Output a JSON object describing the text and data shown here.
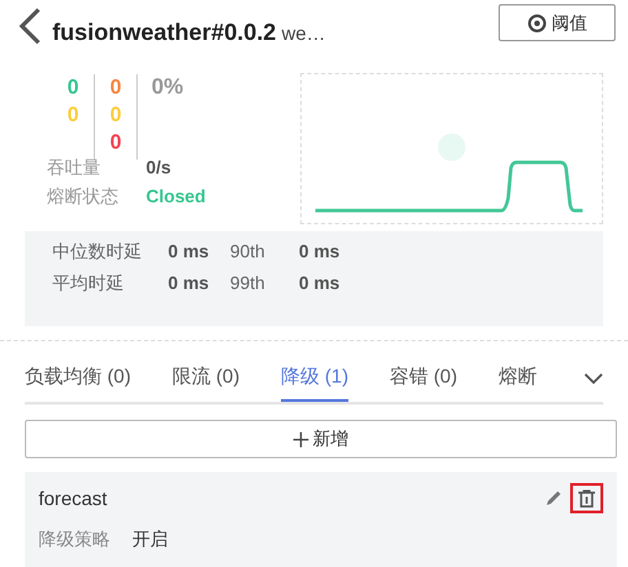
{
  "header": {
    "title": "fusionweather#0.0.2",
    "subtitle": "we…",
    "threshold_button": "阈值"
  },
  "counters": [
    {
      "values": [
        {
          "text": "0",
          "color": "#36c690"
        },
        {
          "text": "0",
          "color": "#fbcd3a"
        }
      ]
    },
    {
      "values": [
        {
          "text": "0",
          "color": "#f7863f"
        },
        {
          "text": "0",
          "color": "#fbcd3a"
        },
        {
          "text": "0",
          "color": "#f5434f"
        }
      ]
    }
  ],
  "percentage": "0%",
  "stats": [
    {
      "label": "吞吐量",
      "value": "0/s",
      "kind": "plain"
    },
    {
      "label": "熔断状态",
      "value": "Closed",
      "kind": "status"
    }
  ],
  "latency": [
    {
      "label": "中位数时延",
      "value": "0 ms",
      "percentile": "90th",
      "percentile_value": "0 ms"
    },
    {
      "label": "平均时延",
      "value": "0 ms",
      "percentile": "99th",
      "percentile_value": "0 ms"
    }
  ],
  "tabs": [
    {
      "label": "负载均衡 (0)",
      "selected": false
    },
    {
      "label": "限流 (0)",
      "selected": false
    },
    {
      "label": "降级 (1)",
      "selected": true
    },
    {
      "label": "容错 (0)",
      "selected": false
    },
    {
      "label": "熔断",
      "selected": false
    }
  ],
  "add_button": "新增",
  "rules": [
    {
      "name": "forecast",
      "field_label": "降级策略",
      "field_value": "开启"
    }
  ]
}
